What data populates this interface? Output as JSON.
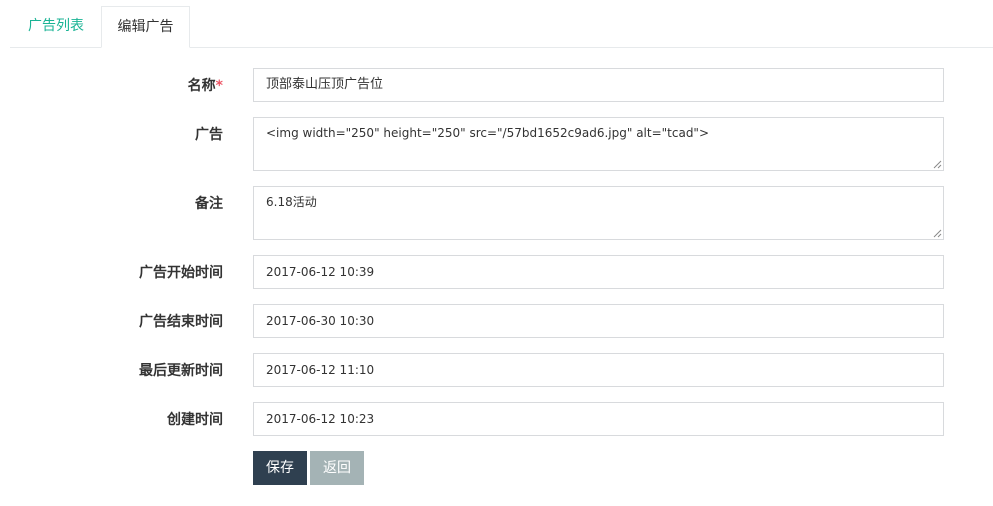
{
  "tabs": [
    {
      "label": "广告列表",
      "active": false
    },
    {
      "label": "编辑广告",
      "active": true
    }
  ],
  "form": {
    "name": {
      "label": "名称",
      "required_mark": "*",
      "value": "顶部泰山压顶广告位"
    },
    "ad": {
      "label": "广告",
      "value": "<img width=\"250\" height=\"250\" src=\"/57bd1652c9ad6.jpg\" alt=\"tcad\">"
    },
    "note": {
      "label": "备注",
      "value": "6.18活动"
    },
    "start_time": {
      "label": "广告开始时间",
      "value": "2017-06-12 10:39"
    },
    "end_time": {
      "label": "广告结束时间",
      "value": "2017-06-30 10:30"
    },
    "updated_time": {
      "label": "最后更新时间",
      "value": "2017-06-12 11:10"
    },
    "created_time": {
      "label": "创建时间",
      "value": "2017-06-12 10:23"
    }
  },
  "buttons": {
    "save_label": "保存",
    "back_label": "返回"
  },
  "colors": {
    "active_tab_text": "#1ab394",
    "required_mark": "#ed5565",
    "save_button": "#2f4050",
    "back_button": "#a4b3b5"
  }
}
